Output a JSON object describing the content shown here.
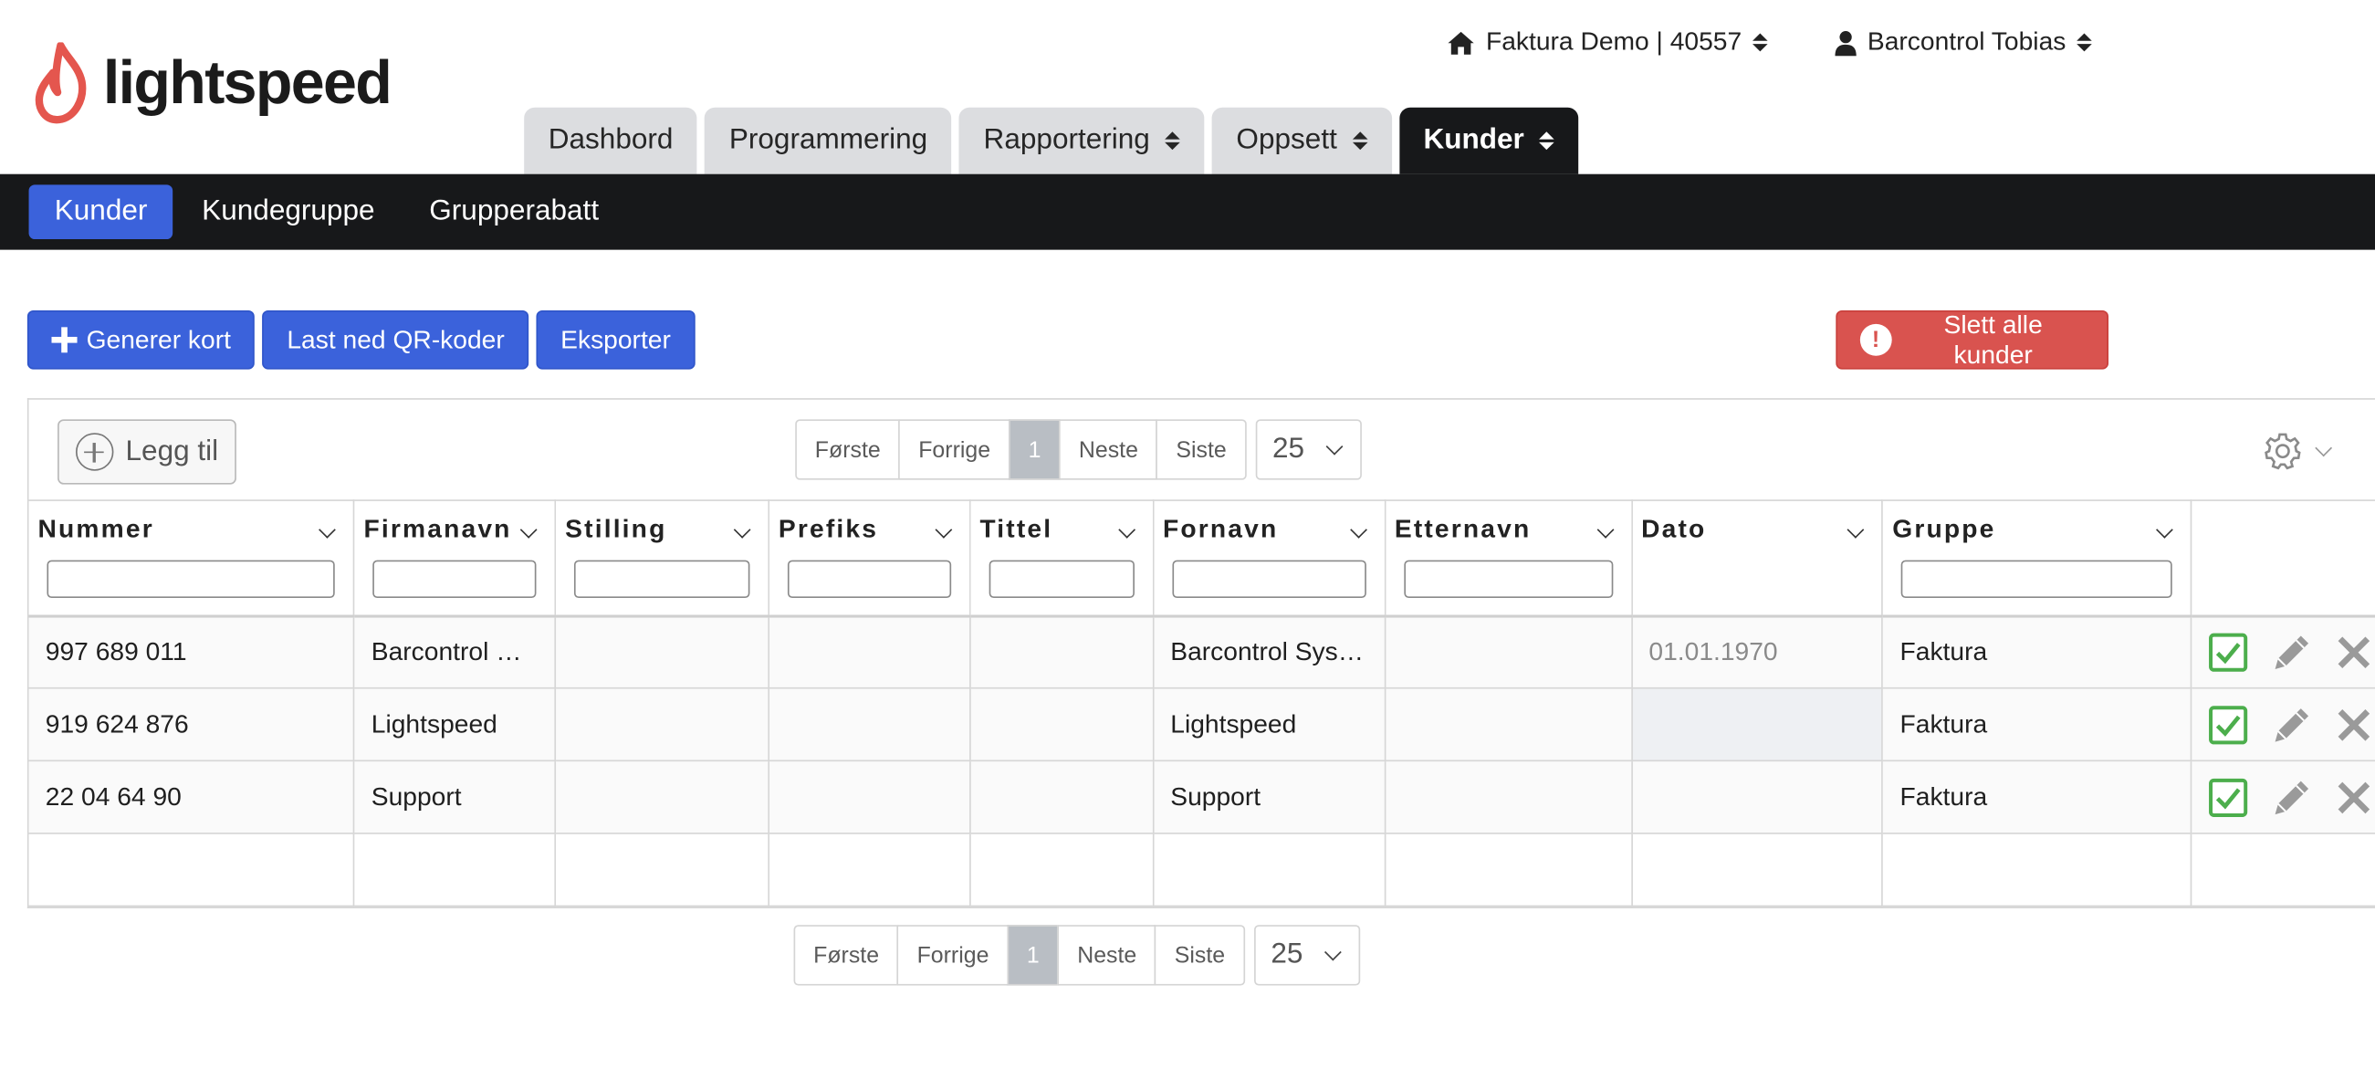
{
  "brand": {
    "name": "lightspeed",
    "color": "#e4564e"
  },
  "header": {
    "store_menu": {
      "icon": "home-icon",
      "label": "Faktura Demo | 40557"
    },
    "user_menu": {
      "icon": "user-icon",
      "label": "Barcontrol Tobias"
    }
  },
  "main_tabs": [
    {
      "label": "Dashbord",
      "has_caret": false,
      "active": false
    },
    {
      "label": "Programmering",
      "has_caret": false,
      "active": false
    },
    {
      "label": "Rapportering",
      "has_caret": true,
      "active": false
    },
    {
      "label": "Oppsett",
      "has_caret": true,
      "active": false
    },
    {
      "label": "Kunder",
      "has_caret": true,
      "active": true
    }
  ],
  "sub_nav": [
    {
      "label": "Kunder",
      "active": true
    },
    {
      "label": "Kundegruppe",
      "active": false
    },
    {
      "label": "Grupperabatt",
      "active": false
    }
  ],
  "actions": {
    "generate_cards": "Generer kort",
    "download_qr": "Last ned QR-koder",
    "export": "Eksporter",
    "delete_all": "Slett alle kunder"
  },
  "grid_toolbar": {
    "add_label": "Legg til",
    "pager": {
      "first": "Første",
      "prev": "Forrige",
      "current": "1",
      "next": "Neste",
      "last": "Siste"
    },
    "page_size": "25"
  },
  "columns": [
    {
      "label": "Nummer",
      "filter": true
    },
    {
      "label": "Firmanavn",
      "filter": true
    },
    {
      "label": "Stilling",
      "filter": true
    },
    {
      "label": "Prefiks",
      "filter": true
    },
    {
      "label": "Tittel",
      "filter": true
    },
    {
      "label": "Fornavn",
      "filter": true
    },
    {
      "label": "Etternavn",
      "filter": true
    },
    {
      "label": "Dato",
      "filter": false
    },
    {
      "label": "Gruppe",
      "filter": true
    }
  ],
  "rows": [
    {
      "nummer": "997 689 011",
      "firmanavn": "Barcontrol …",
      "stilling": "",
      "prefiks": "",
      "tittel": "",
      "fornavn": "Barcontrol Sys…",
      "etternavn": "",
      "dato": "01.01.1970",
      "gruppe": "Faktura"
    },
    {
      "nummer": "919 624 876",
      "firmanavn": "Lightspeed",
      "stilling": "",
      "prefiks": "",
      "tittel": "",
      "fornavn": "Lightspeed",
      "etternavn": "",
      "dato": "",
      "gruppe": "Faktura"
    },
    {
      "nummer": "22 04 64 90",
      "firmanavn": "Support",
      "stilling": "",
      "prefiks": "",
      "tittel": "",
      "fornavn": "Support",
      "etternavn": "",
      "dato": "",
      "gruppe": "Faktura"
    }
  ],
  "row_action_icons": [
    "checkbox-checked-icon",
    "pencil-icon",
    "close-icon"
  ],
  "colors": {
    "primary": "#3b62db",
    "danger": "#d9534f",
    "dark_nav": "#17181a",
    "success": "#4cae4c"
  }
}
